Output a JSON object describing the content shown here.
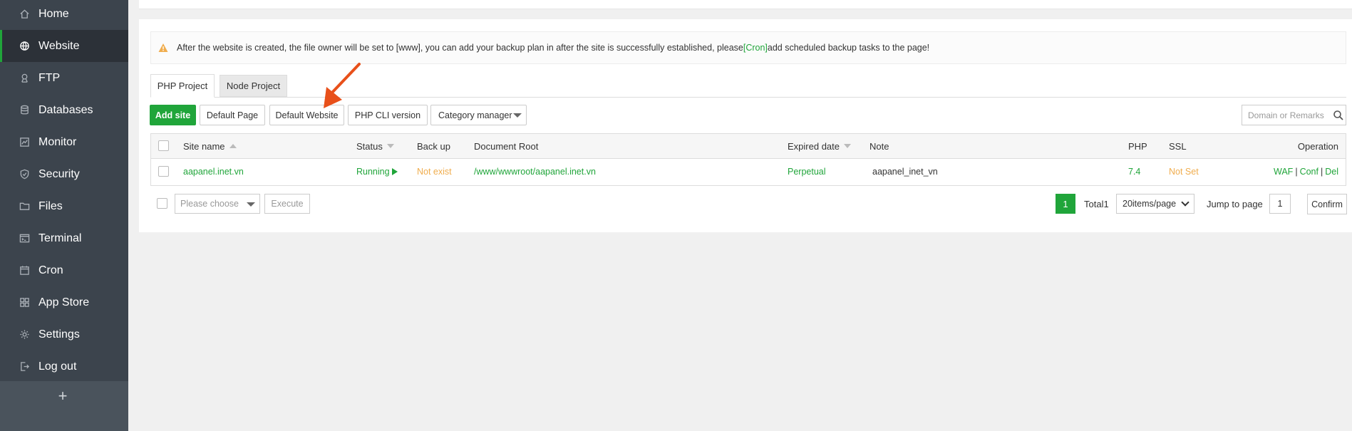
{
  "sidebar": {
    "items": [
      {
        "label": "Home",
        "icon": "home-icon"
      },
      {
        "label": "Website",
        "icon": "globe-icon",
        "active": true
      },
      {
        "label": "FTP",
        "icon": "ftp-icon"
      },
      {
        "label": "Databases",
        "icon": "database-icon"
      },
      {
        "label": "Monitor",
        "icon": "monitor-icon"
      },
      {
        "label": "Security",
        "icon": "shield-icon"
      },
      {
        "label": "Files",
        "icon": "folder-icon"
      },
      {
        "label": "Terminal",
        "icon": "terminal-icon"
      },
      {
        "label": "Cron",
        "icon": "cron-icon"
      },
      {
        "label": "App Store",
        "icon": "grid-icon"
      },
      {
        "label": "Settings",
        "icon": "gear-icon"
      },
      {
        "label": "Log out",
        "icon": "logout-icon"
      }
    ],
    "add": "+"
  },
  "notice": {
    "text_before": "After the website is created, the file owner will be set to [www], you can add your backup plan in after the site is successfully established, please",
    "link": "[Cron]",
    "text_after": "add scheduled backup tasks to the page!"
  },
  "tabs": [
    {
      "label": "PHP Project",
      "active": true
    },
    {
      "label": "Node Project",
      "active": false
    }
  ],
  "toolbar": {
    "add_site": "Add site",
    "default_page": "Default Page",
    "default_website": "Default Website",
    "php_cli": "PHP CLI version",
    "category_manager": "Category manager",
    "search_placeholder": "Domain or Remarks"
  },
  "table": {
    "headers": {
      "site_name": "Site name",
      "status": "Status",
      "backup": "Back up",
      "doc_root": "Document Root",
      "expired": "Expired date",
      "note": "Note",
      "php": "PHP",
      "ssl": "SSL",
      "operation": "Operation"
    },
    "rows": [
      {
        "site_name": "aapanel.inet.vn",
        "status": "Running",
        "backup": "Not exist",
        "doc_root": "/www/wwwroot/aapanel.inet.vn",
        "expired": "Perpetual",
        "note": "aapanel_inet_vn",
        "php": "7.4",
        "ssl": "Not Set",
        "ops": [
          "WAF",
          "Conf",
          "Del"
        ],
        "ops_sep": "|"
      }
    ]
  },
  "bulk": {
    "placeholder": "Please choose",
    "execute": "Execute"
  },
  "pagination": {
    "current": "1",
    "total": "Total1",
    "per_page": "20items/page",
    "jump_label": "Jump to page",
    "jump_value": "1",
    "confirm": "Confirm"
  },
  "colors": {
    "accent": "#20a53a",
    "warning": "#f0ad4e",
    "sidebar": "#3c444d",
    "annotation_arrow": "#e8501a"
  }
}
